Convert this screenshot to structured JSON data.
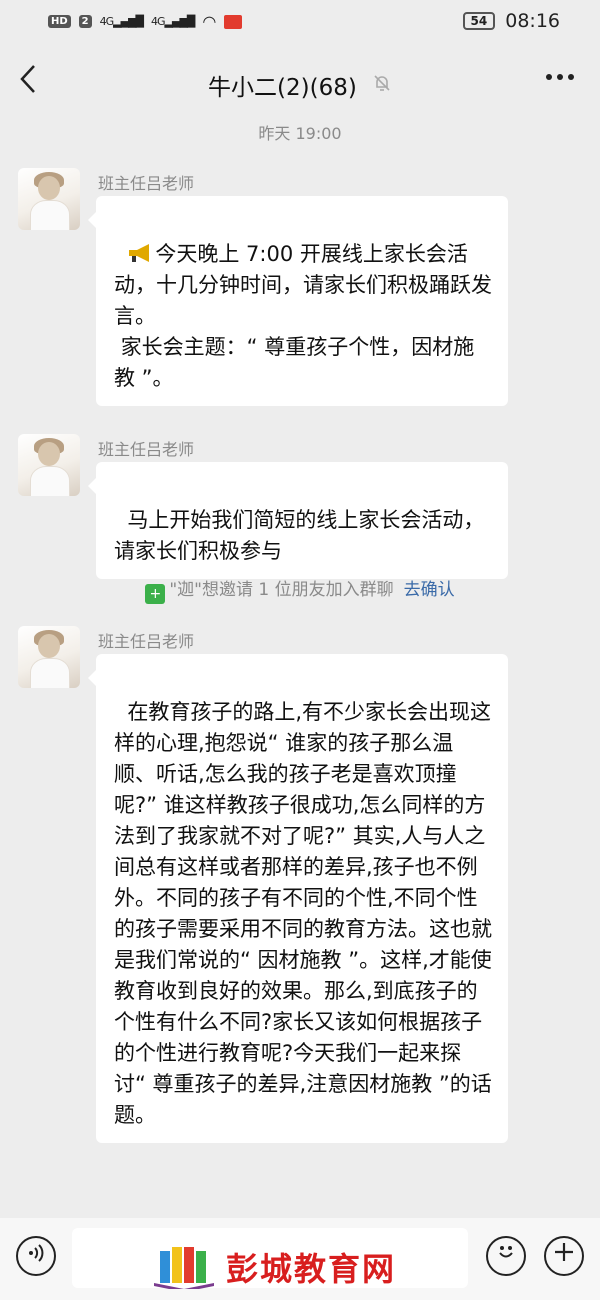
{
  "status_bar": {
    "hd_tag": "HD",
    "sim1": "2",
    "net1": "4G",
    "net2": "4G",
    "battery": "54",
    "time": "08:16"
  },
  "header": {
    "back_icon": "chevron-left-icon",
    "title": "牛小二(2)(68)",
    "mute_icon": "bell-off-icon",
    "more_icon": "more-dots-icon"
  },
  "timestamp": "昨天 19:00",
  "messages": [
    {
      "sender": "班主任吕老师",
      "text": "今天晚上 7:00 开展线上家长会活动，十几分钟时间，请家长们积极踊跃发\n言。\n 家长会主题：“ 尊重孩子个性，因材施教 ”。"
    },
    {
      "sender": "班主任吕老师",
      "text": "马上开始我们简短的线上家长会活动，请家长们积极参与"
    },
    {
      "sender": "班主任吕老师",
      "text": "在教育孩子的路上,有不少家长会出现这样的心理,抱怨说“ 谁家的孩子那么温顺、听话,怎么我的孩子老是喜欢顶撞呢?” 谁这样教孩子很成功,怎么同样的方法到了我家就不对了呢?” 其实,人与人之间总有这样或者那样的差异,孩子也不例外。不同的孩子有不同的个性,不同个性的孩子需要采用不同的教育方法。这也就是我们常说的“ 因材施教 ”。这样,才能使教育收到良好的效果。那么,到底孩子的个性有什么不同?家长又该如何根据孩子的个性进行教育呢?今天我们一起来探讨“ 尊重孩子的差异,注意因材施教 ”的话题。"
    }
  ],
  "system_message": {
    "text": "\"迦\"想邀请 1 位朋友加入群聊",
    "link": "去确认"
  },
  "bottom_bar": {
    "voice_icon": "voice-icon",
    "emoji_icon": "emoji-icon",
    "plus_icon": "plus-icon"
  },
  "watermark": {
    "text": "彭城教育网"
  }
}
